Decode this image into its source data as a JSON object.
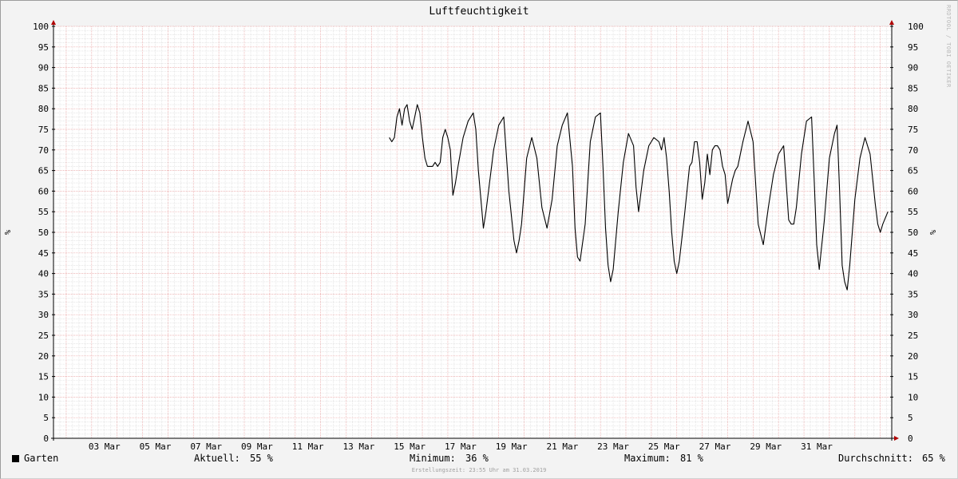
{
  "chart_data": {
    "type": "line",
    "title": "Luftfeuchtigkeit",
    "ylabel": "%",
    "ylabel_right": "%",
    "ylim": [
      0,
      100
    ],
    "yticks": [
      0,
      5,
      10,
      15,
      20,
      25,
      30,
      35,
      40,
      45,
      50,
      55,
      60,
      65,
      70,
      75,
      80,
      85,
      90,
      95,
      100
    ],
    "xlim_days": [
      1.5,
      32.0
    ],
    "xticks": [
      {
        "day": 3,
        "label": "03 Mar"
      },
      {
        "day": 5,
        "label": "05 Mar"
      },
      {
        "day": 7,
        "label": "07 Mar"
      },
      {
        "day": 9,
        "label": "09 Mar"
      },
      {
        "day": 11,
        "label": "11 Mar"
      },
      {
        "day": 13,
        "label": "13 Mar"
      },
      {
        "day": 15,
        "label": "15 Mar"
      },
      {
        "day": 17,
        "label": "17 Mar"
      },
      {
        "day": 19,
        "label": "19 Mar"
      },
      {
        "day": 21,
        "label": "21 Mar"
      },
      {
        "day": 23,
        "label": "23 Mar"
      },
      {
        "day": 25,
        "label": "25 Mar"
      },
      {
        "day": 27,
        "label": "27 Mar"
      },
      {
        "day": 29,
        "label": "29 Mar"
      },
      {
        "day": 31,
        "label": "31 Mar"
      }
    ],
    "grid": true,
    "series": [
      {
        "name": "Garten",
        "color": "#000000",
        "points": [
          [
            14.7,
            73
          ],
          [
            14.8,
            72
          ],
          [
            14.9,
            73
          ],
          [
            15.0,
            78
          ],
          [
            15.1,
            80
          ],
          [
            15.2,
            76
          ],
          [
            15.3,
            80
          ],
          [
            15.4,
            81
          ],
          [
            15.5,
            77
          ],
          [
            15.6,
            75
          ],
          [
            15.7,
            78
          ],
          [
            15.8,
            81
          ],
          [
            15.9,
            79
          ],
          [
            16.0,
            73
          ],
          [
            16.1,
            68
          ],
          [
            16.2,
            66
          ],
          [
            16.3,
            66
          ],
          [
            16.4,
            66
          ],
          [
            16.5,
            67
          ],
          [
            16.6,
            66
          ],
          [
            16.7,
            67
          ],
          [
            16.8,
            73
          ],
          [
            16.9,
            75
          ],
          [
            17.0,
            73
          ],
          [
            17.1,
            70
          ],
          [
            17.2,
            59
          ],
          [
            17.3,
            62
          ],
          [
            17.4,
            66
          ],
          [
            17.6,
            73
          ],
          [
            17.8,
            77
          ],
          [
            18.0,
            79
          ],
          [
            18.1,
            75
          ],
          [
            18.2,
            65
          ],
          [
            18.3,
            58
          ],
          [
            18.4,
            51
          ],
          [
            18.5,
            55
          ],
          [
            18.6,
            60
          ],
          [
            18.8,
            70
          ],
          [
            19.0,
            76
          ],
          [
            19.2,
            78
          ],
          [
            19.4,
            60
          ],
          [
            19.6,
            48
          ],
          [
            19.7,
            45
          ],
          [
            19.8,
            48
          ],
          [
            19.9,
            52
          ],
          [
            20.1,
            68
          ],
          [
            20.3,
            73
          ],
          [
            20.5,
            68
          ],
          [
            20.7,
            56
          ],
          [
            20.9,
            51
          ],
          [
            21.1,
            58
          ],
          [
            21.3,
            71
          ],
          [
            21.5,
            76
          ],
          [
            21.7,
            79
          ],
          [
            21.9,
            66
          ],
          [
            22.0,
            51
          ],
          [
            22.1,
            44
          ],
          [
            22.2,
            43
          ],
          [
            22.4,
            52
          ],
          [
            22.6,
            72
          ],
          [
            22.8,
            78
          ],
          [
            23.0,
            79
          ],
          [
            23.1,
            66
          ],
          [
            23.2,
            51
          ],
          [
            23.3,
            42
          ],
          [
            23.4,
            38
          ],
          [
            23.5,
            41
          ],
          [
            23.7,
            55
          ],
          [
            23.9,
            67
          ],
          [
            24.1,
            74
          ],
          [
            24.3,
            71
          ],
          [
            24.4,
            61
          ],
          [
            24.5,
            55
          ],
          [
            24.7,
            65
          ],
          [
            24.9,
            71
          ],
          [
            25.1,
            73
          ],
          [
            25.3,
            72
          ],
          [
            25.4,
            70
          ],
          [
            25.5,
            73
          ],
          [
            25.6,
            68
          ],
          [
            25.7,
            60
          ],
          [
            25.8,
            50
          ],
          [
            25.9,
            43
          ],
          [
            26.0,
            40
          ],
          [
            26.1,
            43
          ],
          [
            26.3,
            54
          ],
          [
            26.5,
            66
          ],
          [
            26.6,
            67
          ],
          [
            26.7,
            72
          ],
          [
            26.8,
            72
          ],
          [
            26.9,
            67
          ],
          [
            27.0,
            58
          ],
          [
            27.1,
            62
          ],
          [
            27.2,
            69
          ],
          [
            27.3,
            64
          ],
          [
            27.4,
            70
          ],
          [
            27.5,
            71
          ],
          [
            27.6,
            71
          ],
          [
            27.7,
            70
          ],
          [
            27.8,
            66
          ],
          [
            27.9,
            64
          ],
          [
            28.0,
            57
          ],
          [
            28.1,
            60
          ],
          [
            28.2,
            63
          ],
          [
            28.3,
            65
          ],
          [
            28.4,
            66
          ],
          [
            28.6,
            72
          ],
          [
            28.8,
            77
          ],
          [
            29.0,
            72
          ],
          [
            29.2,
            52
          ],
          [
            29.4,
            47
          ],
          [
            29.6,
            56
          ],
          [
            29.8,
            64
          ],
          [
            30.0,
            69
          ],
          [
            30.2,
            71
          ],
          [
            30.3,
            62
          ],
          [
            30.4,
            53
          ],
          [
            30.5,
            52
          ],
          [
            30.6,
            52
          ],
          [
            30.7,
            56
          ],
          [
            30.9,
            69
          ],
          [
            31.1,
            77
          ],
          [
            31.3,
            78
          ],
          [
            31.4,
            63
          ],
          [
            31.5,
            47
          ],
          [
            31.6,
            41
          ],
          [
            31.8,
            53
          ],
          [
            32.0,
            68
          ],
          [
            32.2,
            74
          ],
          [
            32.3,
            76
          ],
          [
            32.4,
            60
          ],
          [
            32.5,
            42
          ],
          [
            32.6,
            38
          ],
          [
            32.7,
            36
          ],
          [
            32.8,
            42
          ],
          [
            33.0,
            58
          ],
          [
            33.2,
            68
          ],
          [
            33.4,
            73
          ],
          [
            33.6,
            69
          ],
          [
            33.8,
            57
          ],
          [
            33.9,
            52
          ],
          [
            34.0,
            50
          ],
          [
            34.1,
            52
          ],
          [
            34.3,
            55
          ]
        ]
      }
    ]
  },
  "legend": {
    "series_label": "Garten",
    "current_label": "Aktuell:",
    "current_value": "55 %",
    "min_label": "Minimum:",
    "min_value": "36 %",
    "max_label": "Maximum:",
    "max_value": "81 %",
    "avg_label": "Durchschnitt:",
    "avg_value": "65 %"
  },
  "footer": "Erstellungszeit: 23:55 Uhr am 31.03.2019",
  "watermark": "RRDTOOL / TOBI OETIKER",
  "colors": {
    "minor_grid": "#d8d8d8",
    "major_grid": "#e9a0a0",
    "axis": "#000000",
    "arrow": "#b00000"
  }
}
